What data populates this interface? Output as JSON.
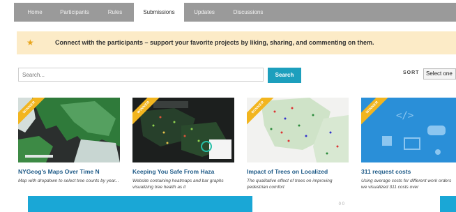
{
  "tabs": [
    {
      "label": "Home",
      "active": false
    },
    {
      "label": "Participants",
      "active": false
    },
    {
      "label": "Rules",
      "active": false
    },
    {
      "label": "Submissions",
      "active": true
    },
    {
      "label": "Updates",
      "active": false
    },
    {
      "label": "Discussions",
      "active": false
    }
  ],
  "banner": {
    "icon": "star-icon",
    "message": "Connect with the participants – support your favorite projects by liking, sharing, and commenting on them."
  },
  "search": {
    "placeholder": "Search...",
    "button_label": "Search"
  },
  "sort": {
    "label": "SORT",
    "selected": "Select one"
  },
  "cards": [
    {
      "badge": "WINNER",
      "title": "NYGeog's Maps Over Time N",
      "description": "Map with dropdown to select tree counts by year..."
    },
    {
      "badge": "WINNER",
      "title": "Keeping You Safe From Haza",
      "description": "Website containing heatmaps and bar graphs visualizing tree health as it"
    },
    {
      "badge": "WINNER",
      "title": "Impact of Trees on Localized",
      "description": "The qualitative effect of trees on improving pedestrian comfort",
      "stats": "0 0"
    },
    {
      "badge": "WINNER",
      "title": "311 request costs",
      "description": "Using average costs for different work orders we visualized 311 costs over"
    }
  ],
  "colors": {
    "tab_bar": "#9a9a9a",
    "banner_bg": "#fcebc7",
    "accent": "#1d9fbd",
    "ribbon": "#f2b51f",
    "title_link": "#1e5a87"
  }
}
